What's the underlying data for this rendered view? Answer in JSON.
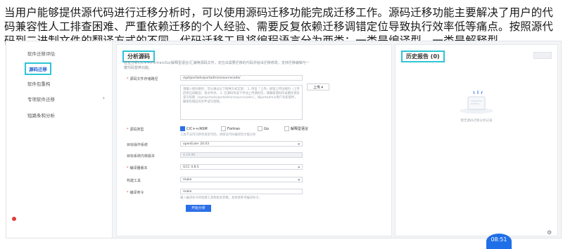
{
  "caption": "当用户能够提供源代码进行迁移分析时，可以使用源码迁移功能完成迁移工作。源码迁移功能主要解决了用户的代码兼容性人工排查困难、严重依赖迁移的个人经验、需要反复依赖迁移调错定位导致执行效率低等痛点。按照源代码到二进制文件的翻译方式的不同，代码迁移工具将编程语言分为两类：一类是编译型，一类是解释型。",
  "sidebar": {
    "items": [
      {
        "label": "软件迁移评估"
      },
      {
        "label": "源码迁移"
      },
      {
        "label": "软件包重构"
      },
      {
        "label": "专项软件迁移"
      },
      {
        "label": "短路条和分析"
      }
    ]
  },
  "panel": {
    "title": "分析源码",
    "desc": "检查分析C/C++/Fortran/Go/解释型语言/汇编等源码文件，定位出需要迁移的代码并给出迁移修改，支持迁移编辑与一键代码替换功能。",
    "source_path": {
      "label": "源码文件存储路径",
      "value": "/opt/portadv/portadmin/sourcecode/",
      "upload_label": "上传",
      "hint": "请输入相对路径，可以通过以下两种方式实现：\n1. 单击「上传」按钮上传压缩包（上传后将自动解压）或文件夹。\n2. 在源码目录下手动上传源码包，请确保源码目录路径具有读写权限（/opt/portadv/portadmin/sourcecode/），如portadmin用户有权限时，确保有相应的文件读写权限。"
    },
    "language": {
      "label": "源码类型",
      "options": [
        {
          "label": "C/C++/ASM",
          "checked": true
        },
        {
          "label": "Fortran",
          "checked": false
        },
        {
          "label": "Go",
          "checked": false
        },
        {
          "label": "解释型语言",
          "checked": false
        }
      ],
      "hint": "工具不支持迁移检查型代码，请保证代码编译后才能分析"
    },
    "target_os": {
      "label": "目标操作系统",
      "value": "openEuler 20.03"
    },
    "target_kernel": {
      "label": "目标系统内核版本",
      "value": "4.19.90"
    },
    "compiler": {
      "label": "编译器版本",
      "value": "GCC 4.8.5"
    },
    "build_tool": {
      "label": "构建工具",
      "value": "make"
    },
    "build_cmd": {
      "label": "编译命令",
      "value": "make",
      "hint": "输入编译命令将构建工具和相关参数，具体请参考编译命令。"
    },
    "start_label": "开始分析"
  },
  "history": {
    "title": "历史报告 (0)",
    "empty": "暂无源码迁移分析记录"
  },
  "time_badge": "08:51"
}
